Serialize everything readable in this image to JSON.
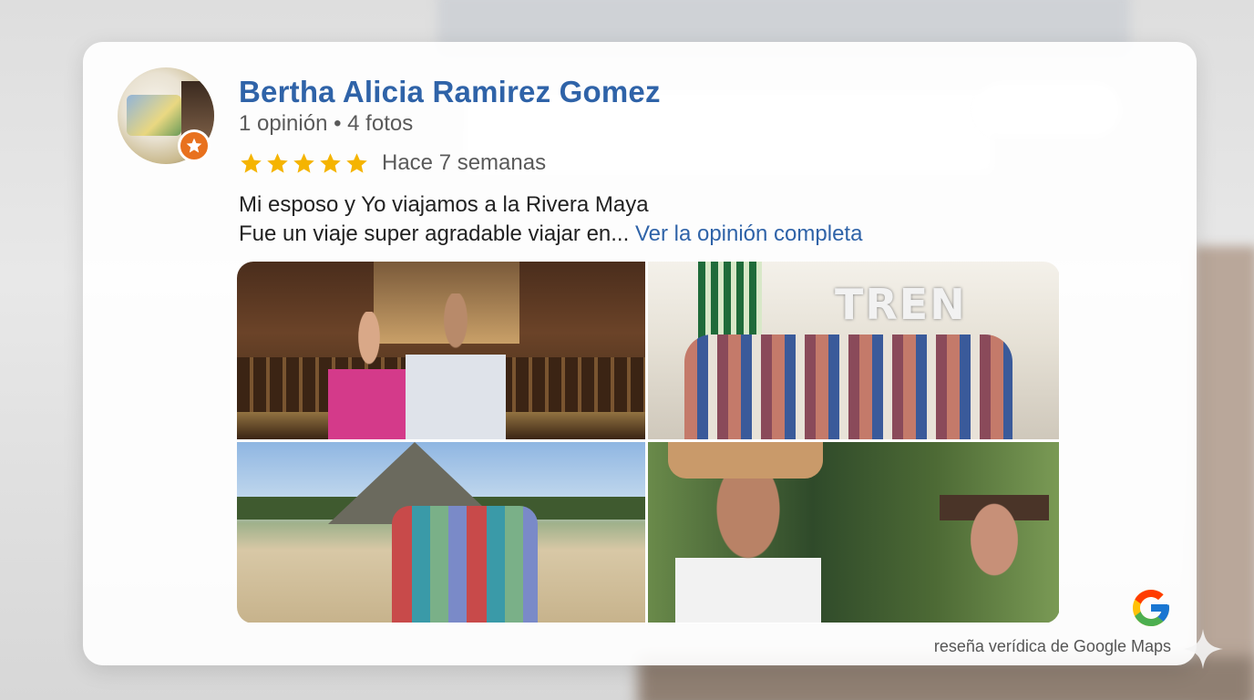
{
  "review": {
    "author_name": "Bertha Alicia Ramirez Gomez",
    "author_meta": "1 opinión • 4 fotos",
    "rating": 5,
    "rating_max": 5,
    "time_ago": "Hace 7 semanas",
    "text_line1": "Mi esposo y Yo viajamos a la Rivera Maya",
    "text_line2": "Fue un viaje super agradable viajar en... ",
    "read_more": "Ver la opinión completa",
    "photos": [
      {
        "icon": "photo-church-couple"
      },
      {
        "icon": "photo-tren-maya-group",
        "sign_text": "TREN"
      },
      {
        "icon": "photo-pyramid-group"
      },
      {
        "icon": "photo-cenote-couple"
      }
    ]
  },
  "footer": {
    "source_text": "reseña verídica de Google Maps"
  },
  "colors": {
    "name": "#2f63a8",
    "link": "#2f63a8",
    "star": "#f5b400",
    "badge": "#e8711e"
  }
}
